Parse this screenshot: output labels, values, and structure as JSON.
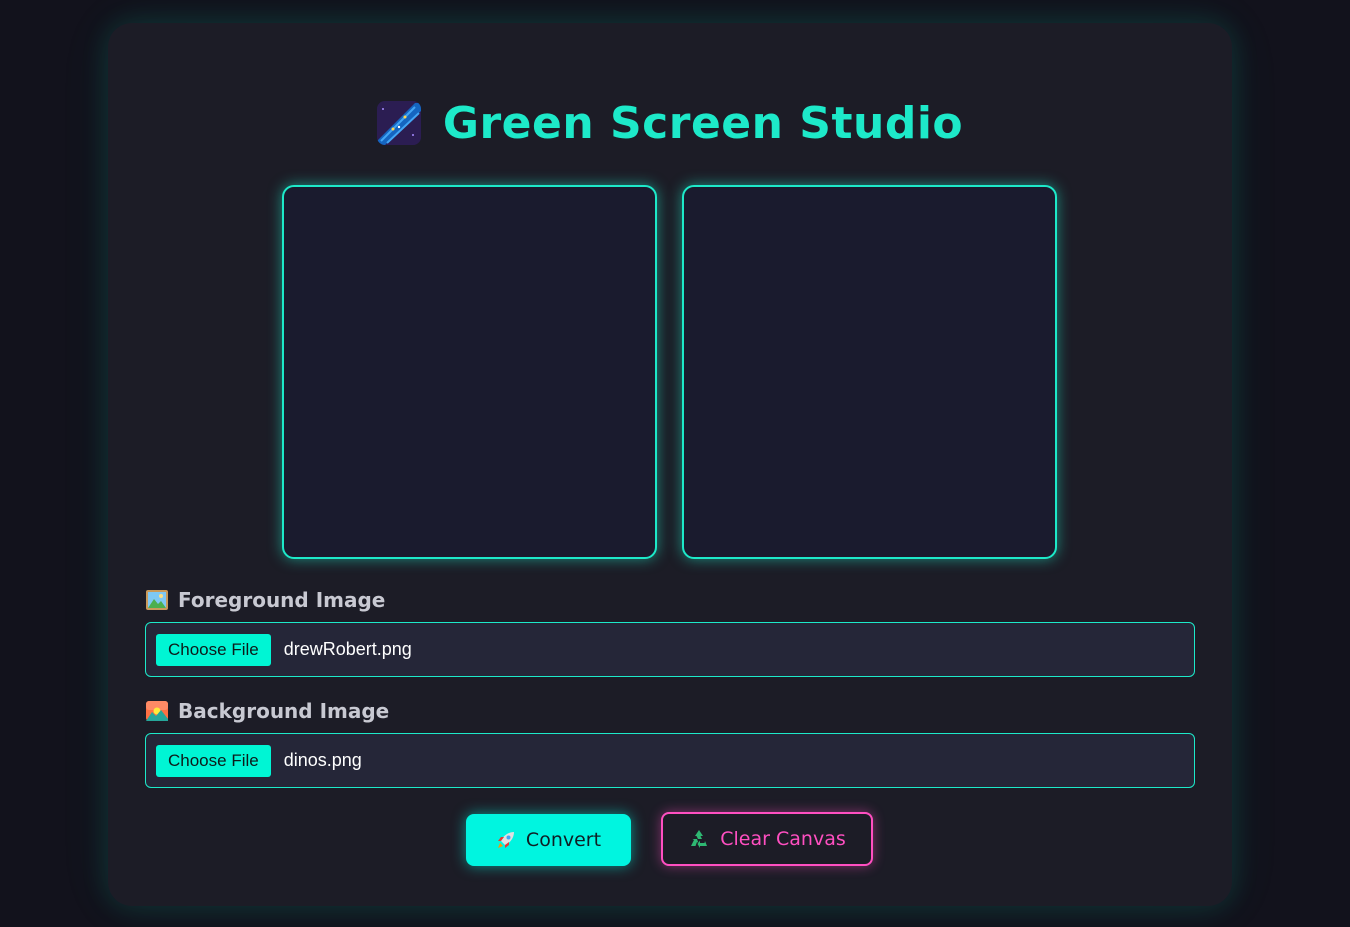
{
  "header": {
    "title": "Green Screen Studio",
    "icon": "shooting-star-icon"
  },
  "canvases": [
    {
      "name": "foreground-canvas"
    },
    {
      "name": "result-canvas"
    }
  ],
  "foreground": {
    "label": "Foreground Image",
    "icon": "framed-picture-icon",
    "button_label": "Choose File",
    "file_name": "drewRobert.png"
  },
  "background": {
    "label": "Background Image",
    "icon": "sunrise-over-mountains-icon",
    "button_label": "Choose File",
    "file_name": "dinos.png"
  },
  "actions": {
    "convert_label": "Convert",
    "convert_icon": "rocket-icon",
    "clear_label": "Clear Canvas",
    "clear_icon": "recycle-icon"
  },
  "colors": {
    "accent": "#1de9c9",
    "button_fill": "#00f5e0",
    "clear_accent": "#ff4fc1",
    "card_bg": "#1c1c26",
    "page_bg": "#12121c"
  }
}
